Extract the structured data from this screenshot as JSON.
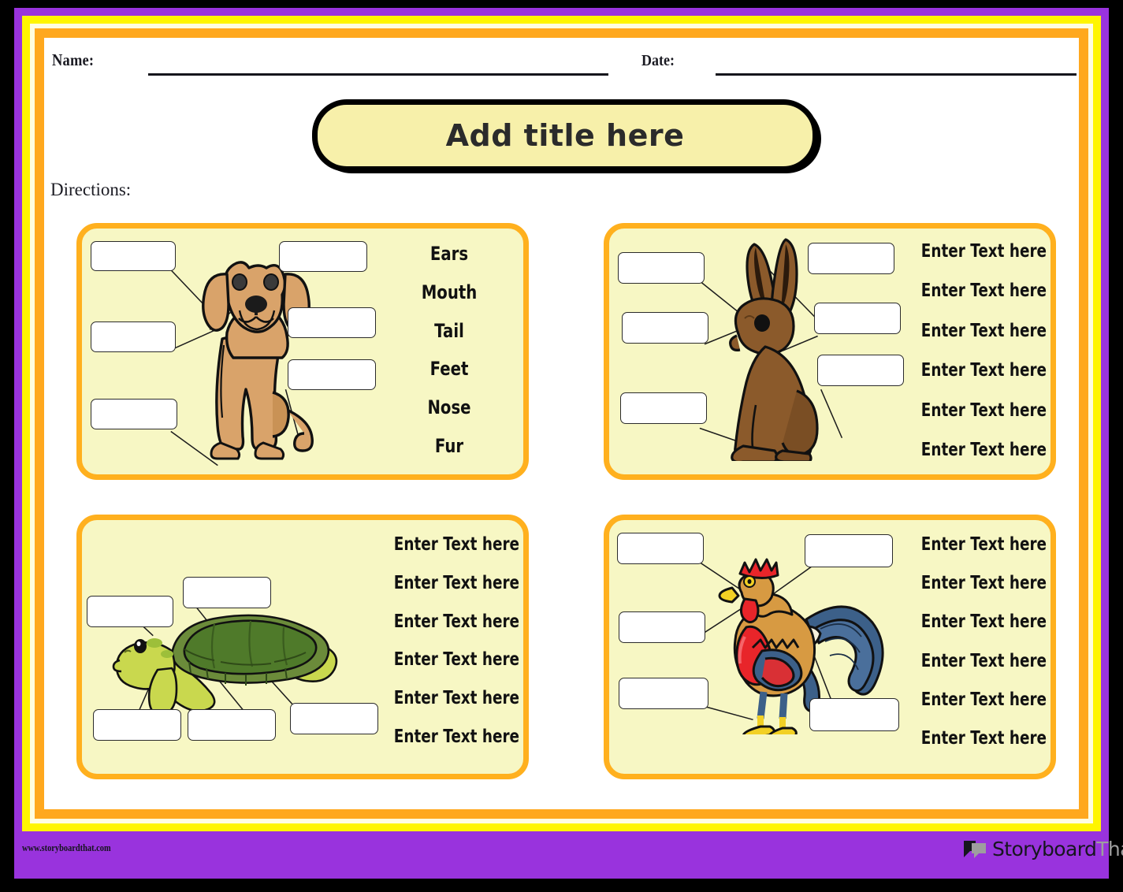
{
  "colors": {
    "outer_black": "#000000",
    "frame_purple": "#9933DD",
    "frame_yellow": "#FFF500",
    "frame_cream": "#FFFDE0",
    "frame_orange": "#FFA81E",
    "sheet_white": "#FFFFFF",
    "panel_fill": "#F7F7C4",
    "panel_border": "#FFB01E",
    "title_fill": "#F7F0AA",
    "dog_body": "#D9A36A",
    "rabbit_body": "#8B5A2B",
    "turtle_shell": "#4F7A2A",
    "turtle_skin": "#C9D84E",
    "rooster_body": "#D79A42",
    "rooster_red": "#E8252A",
    "rooster_blue": "#3C6089",
    "rooster_yellow": "#F2D024"
  },
  "header": {
    "name_label": "Name:",
    "date_label": "Date:",
    "title": "Add title here",
    "directions_label": "Directions:"
  },
  "panels": [
    {
      "id": "dog",
      "animal": "dog",
      "boxes": 6,
      "words": [
        "Ears",
        "Mouth",
        "Tail",
        "Feet",
        "Nose",
        "Fur"
      ]
    },
    {
      "id": "rabbit",
      "animal": "rabbit",
      "boxes": 6,
      "words": [
        "Enter Text here",
        "Enter Text here",
        "Enter Text here",
        "Enter Text here",
        "Enter Text here",
        "Enter Text here"
      ]
    },
    {
      "id": "turtle",
      "animal": "turtle",
      "boxes": 5,
      "words": [
        "Enter Text here",
        "Enter Text here",
        "Enter Text here",
        "Enter Text here",
        "Enter Text here",
        "Enter Text here"
      ]
    },
    {
      "id": "rooster",
      "animal": "rooster",
      "boxes": 5,
      "words": [
        "Enter Text here",
        "Enter Text here",
        "Enter Text here",
        "Enter Text here",
        "Enter Text here",
        "Enter Text here"
      ]
    }
  ],
  "footer": {
    "url": "www.storyboardthat.com",
    "logo_primary": "Storyboard",
    "logo_secondary": "That"
  }
}
